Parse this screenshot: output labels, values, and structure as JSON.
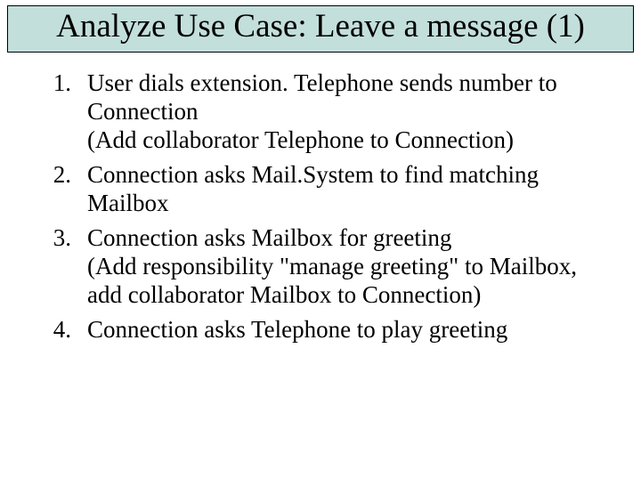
{
  "title": "Analyze Use Case: Leave a message (1)",
  "items": [
    {
      "n": "1.",
      "text": "User dials extension. Telephone sends number to Connection\n(Add collaborator Telephone to Connection)"
    },
    {
      "n": "2.",
      "text": "Connection asks Mail.System to find matching Mailbox"
    },
    {
      "n": "3.",
      "text": "Connection asks Mailbox for greeting\n(Add responsibility \"manage greeting\" to Mailbox,\nadd collaborator Mailbox to Connection)"
    },
    {
      "n": "4.",
      "text": "Connection asks Telephone to play greeting"
    }
  ]
}
